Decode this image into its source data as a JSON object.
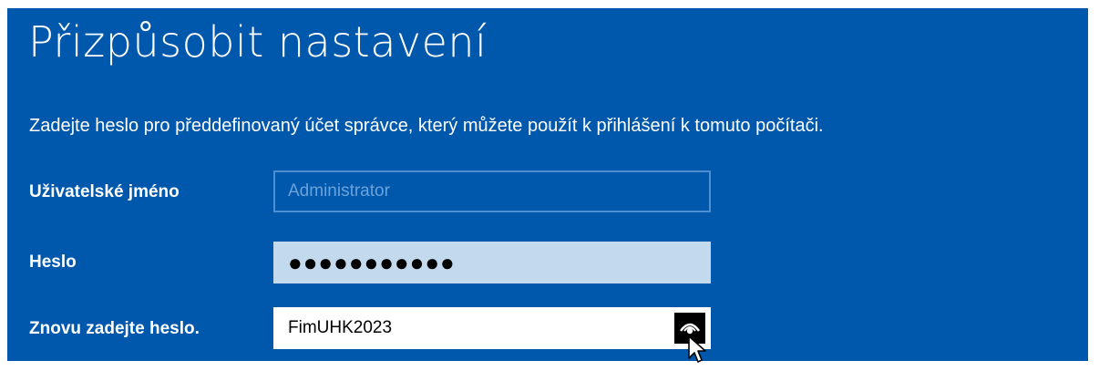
{
  "page": {
    "title": "Přizpůsobit nastavení",
    "description": "Zadejte heslo pro předdefinovaný účet správce, který můžete použít k přihlášení k tomuto počítači."
  },
  "form": {
    "username": {
      "label": "Uživatelské jméno",
      "placeholder": "Administrator"
    },
    "password": {
      "label": "Heslo",
      "masked_value": "●●●●●●●●●●●"
    },
    "confirm_password": {
      "label": "Znovu zadejte heslo.",
      "value": "FimUHK2023",
      "reveal_icon": "eye-icon"
    }
  },
  "colors": {
    "background": "#0058ad",
    "text": "#ffffff",
    "password_field_bg": "#c3d9ee",
    "input_border": "#4d8fd1"
  }
}
